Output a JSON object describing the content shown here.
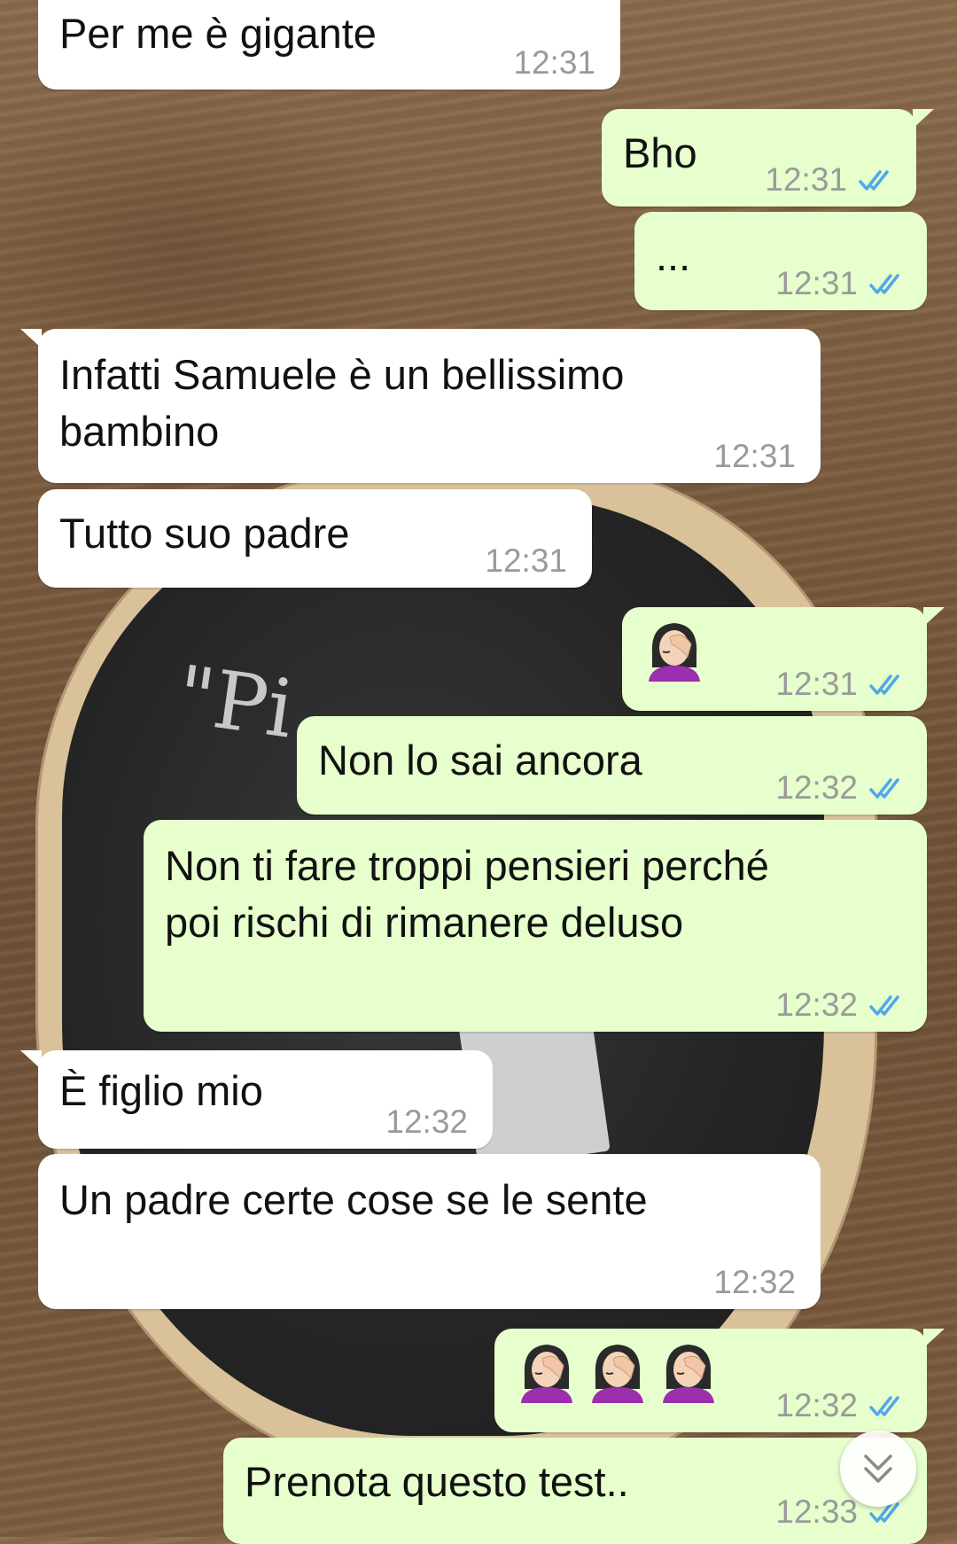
{
  "chat": {
    "messages": [
      {
        "dir": "in",
        "text": "Per me è gigante",
        "time": "12:31"
      },
      {
        "dir": "out",
        "text": "Bho",
        "time": "12:31"
      },
      {
        "dir": "out",
        "text": "...",
        "time": "12:31"
      },
      {
        "dir": "in",
        "text": "Infatti Samuele è un bellissimo\nbambino",
        "time": "12:31"
      },
      {
        "dir": "in",
        "text": "Tutto suo padre",
        "time": "12:31"
      },
      {
        "dir": "out",
        "emoji": [
          "woman-facepalming"
        ],
        "time": "12:31"
      },
      {
        "dir": "out",
        "text": "Non lo sai ancora",
        "time": "12:32"
      },
      {
        "dir": "out",
        "text": "Non ti fare troppi pensieri perché\npoi rischi di rimanere deluso",
        "time": "12:32"
      },
      {
        "dir": "in",
        "text": "È figlio mio",
        "time": "12:32"
      },
      {
        "dir": "in",
        "text": "Un padre certe cose se le sente",
        "time": "12:32"
      },
      {
        "dir": "out",
        "emoji": [
          "woman-facepalming",
          "woman-facepalming",
          "woman-facepalming"
        ],
        "time": "12:32"
      },
      {
        "dir": "out",
        "text": "Prenota questo test..",
        "time": "12:33"
      }
    ],
    "read_receipt_icon": "double-check-icon",
    "read_receipt_color": "#4fa8e8",
    "outgoing_color": "#e6ffcc",
    "incoming_color": "#ffffff"
  },
  "scroll_button": {
    "icon": "double-chevron-down-icon"
  }
}
